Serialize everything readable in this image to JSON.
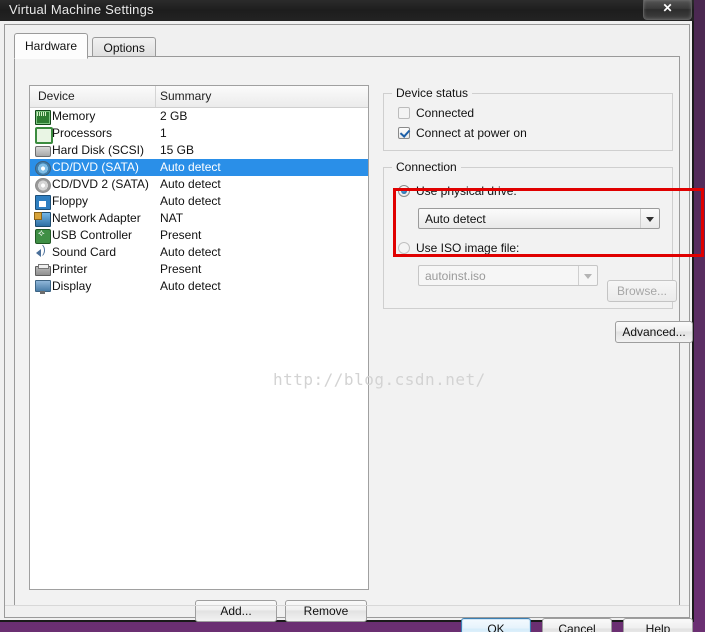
{
  "window": {
    "title": "Virtual Machine Settings",
    "close_label": "✕"
  },
  "tabs": [
    {
      "label": "Hardware",
      "active": true
    },
    {
      "label": "Options",
      "active": false
    }
  ],
  "device_list": {
    "columns": [
      "Device",
      "Summary"
    ],
    "rows": [
      {
        "icon": "memory-icon",
        "device": "Memory",
        "summary": "2 GB",
        "selected": false
      },
      {
        "icon": "processor-icon",
        "device": "Processors",
        "summary": "1",
        "selected": false
      },
      {
        "icon": "hard-disk-icon",
        "device": "Hard Disk (SCSI)",
        "summary": "15 GB",
        "selected": false
      },
      {
        "icon": "cd-dvd-icon",
        "device": "CD/DVD (SATA)",
        "summary": "Auto detect",
        "selected": true
      },
      {
        "icon": "cd-dvd-2-icon",
        "device": "CD/DVD 2 (SATA)",
        "summary": "Auto detect",
        "selected": false
      },
      {
        "icon": "floppy-icon",
        "device": "Floppy",
        "summary": "Auto detect",
        "selected": false
      },
      {
        "icon": "network-adapter-icon",
        "device": "Network Adapter",
        "summary": "NAT",
        "selected": false
      },
      {
        "icon": "usb-controller-icon",
        "device": "USB Controller",
        "summary": "Present",
        "selected": false
      },
      {
        "icon": "sound-card-icon",
        "device": "Sound Card",
        "summary": "Auto detect",
        "selected": false
      },
      {
        "icon": "printer-icon",
        "device": "Printer",
        "summary": "Present",
        "selected": false
      },
      {
        "icon": "display-icon",
        "device": "Display",
        "summary": "Auto detect",
        "selected": false
      }
    ],
    "add_label": "Add...",
    "remove_label": "Remove"
  },
  "device_status": {
    "title": "Device status",
    "connected": {
      "label": "Connected",
      "checked": false,
      "enabled": false
    },
    "connect_at_power_on": {
      "label": "Connect at power on",
      "checked": true,
      "enabled": true
    }
  },
  "connection": {
    "title": "Connection",
    "use_physical_drive": {
      "label": "Use physical drive:",
      "selected": true
    },
    "physical_drive_value": "Auto detect",
    "use_iso_image": {
      "label": "Use ISO image file:",
      "selected": false
    },
    "iso_value": "autoinst.iso",
    "browse_label": "Browse...",
    "advanced_label": "Advanced..."
  },
  "footer": {
    "ok_label": "OK",
    "cancel_label": "Cancel",
    "help_label": "Help"
  },
  "watermark": "http://blog.csdn.net/",
  "colors": {
    "selection": "#2a8fe8",
    "annotation": "#e00000",
    "desktop": "#5d2f66"
  }
}
